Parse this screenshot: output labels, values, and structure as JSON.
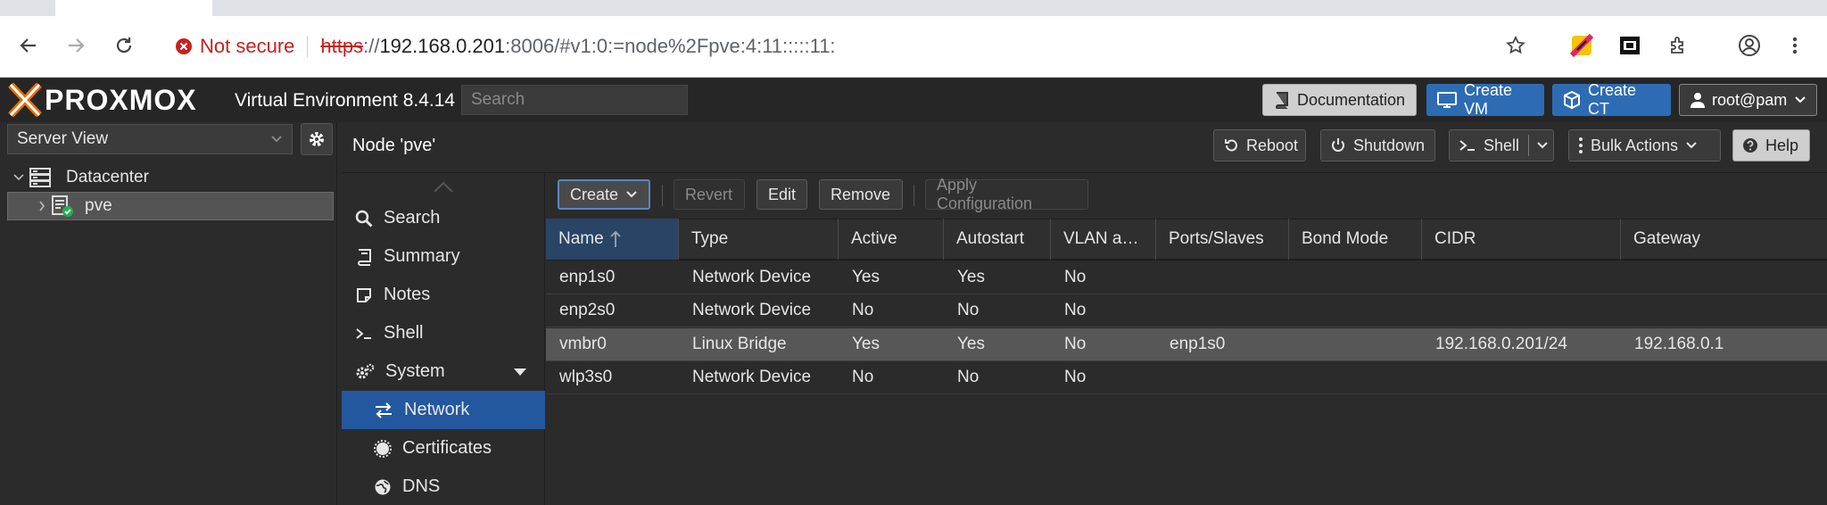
{
  "browser": {
    "not_secure": "Not secure",
    "url_scheme": "https",
    "url_sep": "://",
    "url_host": "192.168.0.201",
    "url_rest": ":8006/#v1:0:=node%2Fpve:4:11:::::11:"
  },
  "header": {
    "logo": "PROXMOX",
    "title": "Virtual Environment 8.4.14",
    "search_placeholder": "Search",
    "documentation": "Documentation",
    "create_vm": "Create VM",
    "create_ct": "Create CT",
    "user": "root@pam"
  },
  "tree": {
    "view": "Server View",
    "datacenter": "Datacenter",
    "node": "pve"
  },
  "node_panel": {
    "title": "Node 'pve'",
    "reboot": "Reboot",
    "shutdown": "Shutdown",
    "shell": "Shell",
    "bulk_actions": "Bulk Actions",
    "help": "Help"
  },
  "menu": {
    "search": "Search",
    "summary": "Summary",
    "notes": "Notes",
    "shell": "Shell",
    "system": "System",
    "network": "Network",
    "certificates": "Certificates",
    "dns": "DNS"
  },
  "toolbar": {
    "create": "Create",
    "revert": "Revert",
    "edit": "Edit",
    "remove": "Remove",
    "apply": "Apply Configuration"
  },
  "grid": {
    "columns": [
      "Name",
      "Type",
      "Active",
      "Autostart",
      "VLAN a…",
      "Ports/Slaves",
      "Bond Mode",
      "CIDR",
      "Gateway"
    ],
    "rows": [
      [
        "enp1s0",
        "Network Device",
        "Yes",
        "Yes",
        "No",
        "",
        "",
        "",
        ""
      ],
      [
        "enp2s0",
        "Network Device",
        "No",
        "No",
        "No",
        "",
        "",
        "",
        ""
      ],
      [
        "vmbr0",
        "Linux Bridge",
        "Yes",
        "Yes",
        "No",
        "enp1s0",
        "",
        "192.168.0.201/24",
        "192.168.0.1"
      ],
      [
        "wlp3s0",
        "Network Device",
        "No",
        "No",
        "No",
        "",
        "",
        "",
        ""
      ]
    ]
  },
  "colors": {
    "accent": "#2d6cb4",
    "selected_menu": "#24589e",
    "logo_orange": "#e57000"
  }
}
